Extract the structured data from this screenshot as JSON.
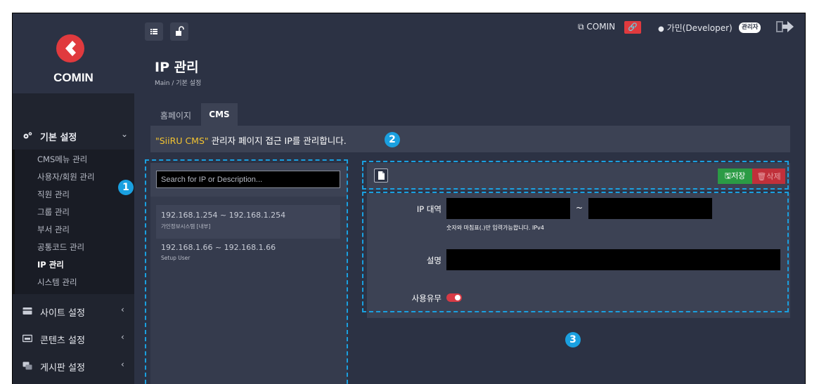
{
  "brand": {
    "name": "COMIN",
    "accent": "#e03a3e"
  },
  "sidebar": {
    "sections": [
      {
        "label": "기본 설정",
        "icon": "gears-icon",
        "expanded": true
      },
      {
        "label": "사이트 설정",
        "icon": "site-icon",
        "expanded": false
      },
      {
        "label": "콘텐츠 설정",
        "icon": "content-icon",
        "expanded": false
      },
      {
        "label": "게시판 설정",
        "icon": "board-icon",
        "expanded": false
      }
    ],
    "items": [
      "CMS메뉴 관리",
      "사용자/회원 관리",
      "직원 관리",
      "그룹 관리",
      "부서 관리",
      "공통코드 관리",
      "IP 관리",
      "시스템 관리"
    ],
    "active_item": "IP 관리"
  },
  "topbar": {
    "site_link": "COMIN",
    "user": "가민(Developer)",
    "role_badge": "관리자"
  },
  "header": {
    "title": "IP 관리",
    "breadcrumb": "Main  /  기본 설정"
  },
  "tabs": [
    {
      "label": "홈페이지",
      "active": false
    },
    {
      "label": "CMS",
      "active": true
    }
  ],
  "notice": {
    "highlight": "\"SiiRU CMS\"",
    "text": " 관리자 페이지 접근 IP를 관리합니다."
  },
  "search": {
    "placeholder": "Search for IP or Description...",
    "value": ""
  },
  "ip_list": [
    {
      "range": "192.168.1.254 ~ 192.168.1.254",
      "desc": "가인정보시스템 [내부]"
    },
    {
      "range": "192.168.1.66 ~ 192.168.1.66",
      "desc": "Setup User"
    }
  ],
  "toolbar": {
    "save_label": "저장",
    "delete_label": "삭제"
  },
  "form": {
    "ip_label": "IP 대역",
    "ip_start": "",
    "ip_end": "",
    "tilde": "~",
    "hint": "숫자와 마침표(.)만 입력가능합니다. IPv4",
    "desc_label": "설명",
    "desc_value": "",
    "use_label": "사용유무",
    "use_enabled": true
  },
  "annotations": [
    "1",
    "2",
    "3"
  ],
  "colors": {
    "annotation": "#1aa0e0",
    "save": "#2b9b45",
    "delete": "#c0303a",
    "notice_highlight": "#f4c430"
  }
}
